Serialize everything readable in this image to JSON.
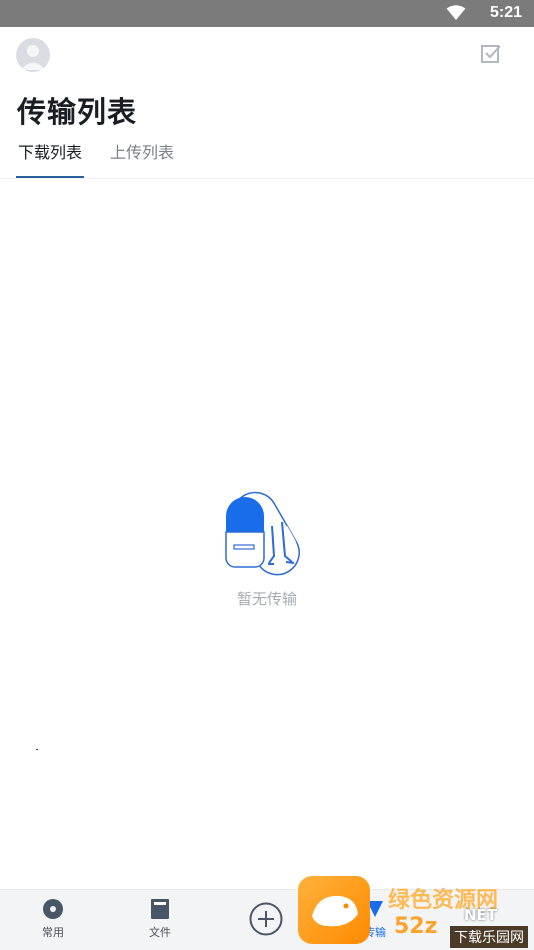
{
  "status_bar": {
    "time": "5:21",
    "wifi_icon": "wifi-icon"
  },
  "header": {
    "avatar_icon": "user-avatar-icon",
    "select_icon": "checkbox-select-icon",
    "title": "传输列表",
    "tabs": [
      {
        "label": "下载列表",
        "active": true
      },
      {
        "label": "上传列表",
        "active": false
      }
    ]
  },
  "empty_state": {
    "text": "暂无传输",
    "icon": "empty-transfer-illustration"
  },
  "tab_bar": {
    "items": [
      {
        "label": "常用",
        "icon": "disc-icon"
      },
      {
        "label": "文件",
        "icon": "file-icon"
      },
      {
        "label": "",
        "icon": "plus-circle-icon"
      },
      {
        "label": "传输",
        "icon": "transfer-icon",
        "active": true
      }
    ]
  },
  "watermark": {
    "text": "绿色资源网",
    "url": "52z",
    "net": "NET",
    "sub": "下载乐园网"
  },
  "colors": {
    "accent": "#1a6dea",
    "tab_underline": "#2a5f9e",
    "status_bar": "#7b7b7b"
  }
}
